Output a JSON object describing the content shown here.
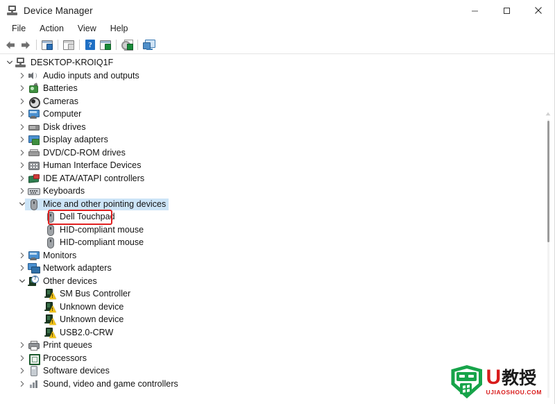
{
  "window": {
    "title": "Device Manager",
    "app_icon": "device-manager-icon",
    "buttons": {
      "minimize": "minimize-icon",
      "maximize": "maximize-icon",
      "close": "close-icon"
    }
  },
  "menubar": {
    "items": [
      {
        "label": "File"
      },
      {
        "label": "Action"
      },
      {
        "label": "View"
      },
      {
        "label": "Help"
      }
    ]
  },
  "toolbar": {
    "buttons": [
      {
        "name": "back-icon"
      },
      {
        "name": "forward-icon"
      },
      {
        "name": "show-hide-console-tree-icon"
      },
      {
        "name": "properties-icon"
      },
      {
        "name": "help-icon",
        "glyph": "?"
      },
      {
        "name": "update-driver-icon"
      },
      {
        "name": "uninstall-device-icon"
      },
      {
        "name": "scan-for-hardware-changes-icon"
      }
    ]
  },
  "tree": {
    "root": {
      "label": "DESKTOP-KROIQ1F",
      "icon": "computer-icon",
      "expanded": true
    },
    "nodes": [
      {
        "label": "Audio inputs and outputs",
        "icon": "speaker-icon",
        "level": 1,
        "expandable": true,
        "expanded": false,
        "selected": false
      },
      {
        "label": "Batteries",
        "icon": "battery-icon",
        "level": 1,
        "expandable": true,
        "expanded": false,
        "selected": false
      },
      {
        "label": "Cameras",
        "icon": "camera-icon",
        "level": 1,
        "expandable": true,
        "expanded": false,
        "selected": false
      },
      {
        "label": "Computer",
        "icon": "monitor-icon",
        "level": 1,
        "expandable": true,
        "expanded": false,
        "selected": false
      },
      {
        "label": "Disk drives",
        "icon": "disk-drive-icon",
        "level": 1,
        "expandable": true,
        "expanded": false,
        "selected": false
      },
      {
        "label": "Display adapters",
        "icon": "display-adapter-icon",
        "level": 1,
        "expandable": true,
        "expanded": false,
        "selected": false
      },
      {
        "label": "DVD/CD-ROM drives",
        "icon": "dvd-drive-icon",
        "level": 1,
        "expandable": true,
        "expanded": false,
        "selected": false
      },
      {
        "label": "Human Interface Devices",
        "icon": "hid-icon",
        "level": 1,
        "expandable": true,
        "expanded": false,
        "selected": false
      },
      {
        "label": "IDE ATA/ATAPI controllers",
        "icon": "ide-controller-icon",
        "level": 1,
        "expandable": true,
        "expanded": false,
        "selected": false
      },
      {
        "label": "Keyboards",
        "icon": "keyboard-icon",
        "level": 1,
        "expandable": true,
        "expanded": false,
        "selected": false
      },
      {
        "label": "Mice and other pointing devices",
        "icon": "mouse-icon",
        "level": 1,
        "expandable": true,
        "expanded": true,
        "selected": true
      },
      {
        "label": "Dell Touchpad",
        "icon": "mouse-icon",
        "level": 2,
        "expandable": false,
        "expanded": false,
        "selected": false,
        "annotated": true
      },
      {
        "label": "HID-compliant mouse",
        "icon": "mouse-icon",
        "level": 2,
        "expandable": false,
        "expanded": false,
        "selected": false
      },
      {
        "label": "HID-compliant mouse",
        "icon": "mouse-icon",
        "level": 2,
        "expandable": false,
        "expanded": false,
        "selected": false
      },
      {
        "label": "Monitors",
        "icon": "monitor-icon",
        "level": 1,
        "expandable": true,
        "expanded": false,
        "selected": false
      },
      {
        "label": "Network adapters",
        "icon": "network-adapter-icon",
        "level": 1,
        "expandable": true,
        "expanded": false,
        "selected": false
      },
      {
        "label": "Other devices",
        "icon": "other-devices-icon",
        "level": 1,
        "expandable": true,
        "expanded": true,
        "selected": false
      },
      {
        "label": "SM Bus Controller",
        "icon": "unknown-device-warning-icon",
        "level": 2,
        "expandable": false,
        "expanded": false,
        "selected": false,
        "warning": true
      },
      {
        "label": "Unknown device",
        "icon": "unknown-device-warning-icon",
        "level": 2,
        "expandable": false,
        "expanded": false,
        "selected": false,
        "warning": true
      },
      {
        "label": "Unknown device",
        "icon": "unknown-device-warning-icon",
        "level": 2,
        "expandable": false,
        "expanded": false,
        "selected": false,
        "warning": true
      },
      {
        "label": "USB2.0-CRW",
        "icon": "unknown-device-warning-icon",
        "level": 2,
        "expandable": false,
        "expanded": false,
        "selected": false,
        "warning": true
      },
      {
        "label": "Print queues",
        "icon": "printer-icon",
        "level": 1,
        "expandable": true,
        "expanded": false,
        "selected": false
      },
      {
        "label": "Processors",
        "icon": "processor-icon",
        "level": 1,
        "expandable": true,
        "expanded": false,
        "selected": false
      },
      {
        "label": "Software devices",
        "icon": "software-device-icon",
        "level": 1,
        "expandable": true,
        "expanded": false,
        "selected": false
      },
      {
        "label": "Sound, video and game controllers",
        "icon": "sound-controller-icon",
        "level": 1,
        "expandable": true,
        "expanded": false,
        "selected": false
      }
    ]
  },
  "annotation": {
    "target_label": "Dell Touchpad",
    "color": "#e02020"
  },
  "scrollbar": {
    "name": "vertical-scrollbar",
    "up_arrow": "scroll-up-icon"
  },
  "watermark": {
    "brand": "U",
    "brand_cn": "教授",
    "domain": "UJIAOSHOU.COM"
  },
  "colors": {
    "selection": "#cce4f7",
    "annotation": "#e02020",
    "text": "#121212"
  }
}
